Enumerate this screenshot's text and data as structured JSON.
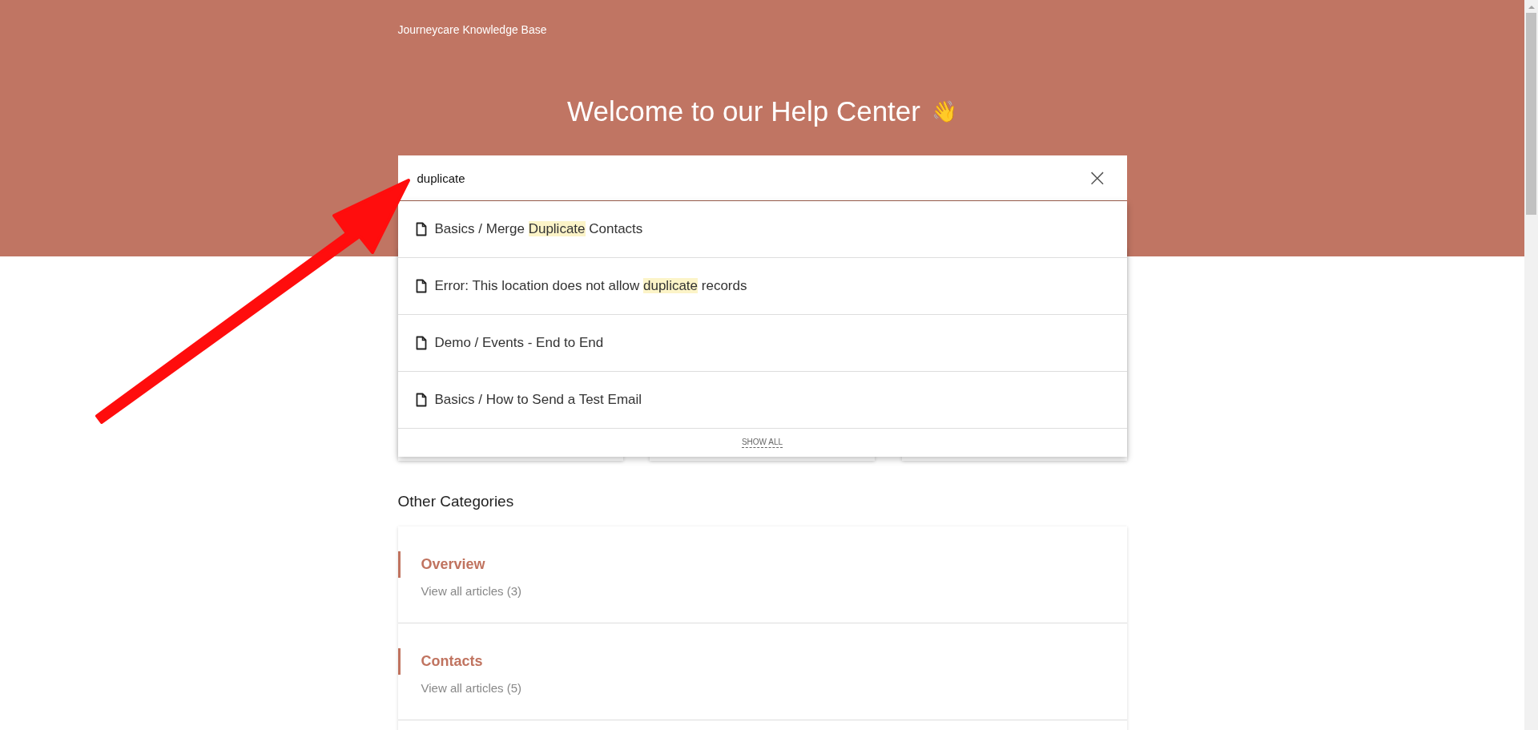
{
  "header": {
    "brand": "Journeycare Knowledge Base",
    "title": "Welcome to our Help Center",
    "title_emoji": "👋"
  },
  "search": {
    "value": "duplicate",
    "clear_label": "×",
    "results": [
      {
        "parts": [
          {
            "text": "Basics / Merge ",
            "highlighted": false
          },
          {
            "text": "Duplicate",
            "highlighted": true
          },
          {
            "text": " Contacts",
            "highlighted": false
          }
        ]
      },
      {
        "parts": [
          {
            "text": "Error: This location does not allow ",
            "highlighted": false
          },
          {
            "text": "duplicate",
            "highlighted": true
          },
          {
            "text": " records",
            "highlighted": false
          }
        ]
      },
      {
        "parts": [
          {
            "text": "Demo / Events - End to End",
            "highlighted": false
          }
        ]
      },
      {
        "parts": [
          {
            "text": "Basics / How to Send a Test Email",
            "highlighted": false
          }
        ]
      }
    ],
    "show_all": "SHOW ALL"
  },
  "other_categories": {
    "heading": "Other Categories",
    "items": [
      {
        "title": "Overview",
        "link": "View all articles (3)"
      },
      {
        "title": "Contacts",
        "link": "View all articles (5)"
      }
    ]
  }
}
